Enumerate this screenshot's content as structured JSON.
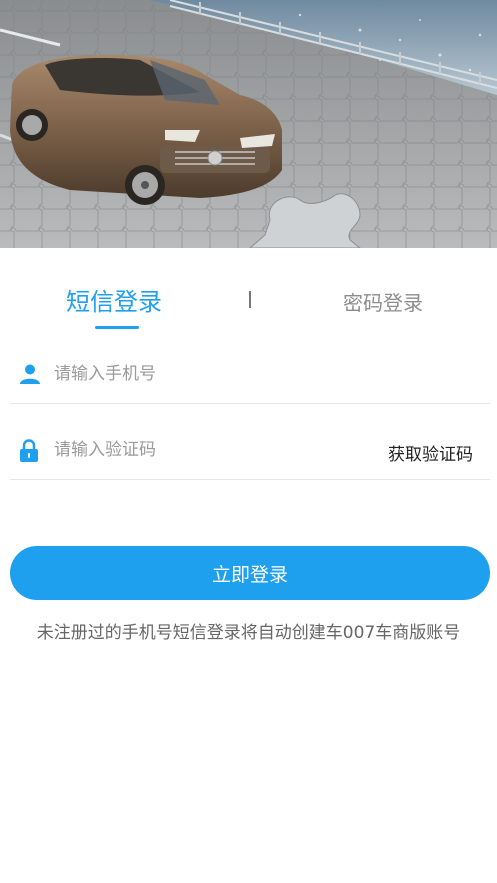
{
  "tabs": {
    "sms_login": "短信登录",
    "password_login": "密码登录"
  },
  "phone": {
    "icon": "person-icon",
    "placeholder": "请输入手机号",
    "value": ""
  },
  "code": {
    "icon": "lock-icon",
    "placeholder": "请输入验证码",
    "value": "",
    "get_code_label": "获取验证码"
  },
  "login_button": "立即登录",
  "notice": "未注册过的手机号短信登录将自动创建车007车商版账号",
  "colors": {
    "accent": "#1ea0ee",
    "inactive_tab": "#8d8d8d",
    "divider": "#e6e6e6"
  }
}
